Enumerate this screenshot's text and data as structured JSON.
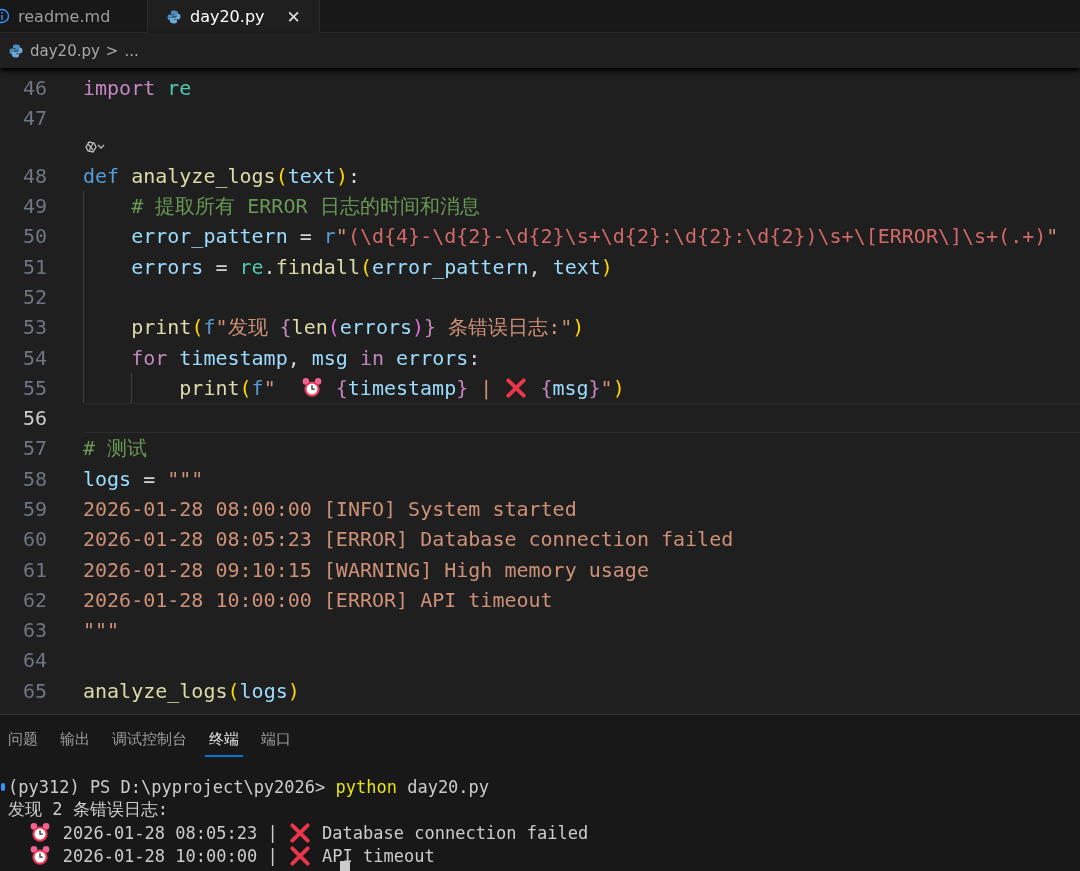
{
  "tabs": [
    {
      "label": "readme.md",
      "selected": false
    },
    {
      "label": "day20.py",
      "selected": true,
      "close": "✕"
    }
  ],
  "breadcrumb": {
    "file": "day20.py",
    "separator": ">",
    "rest": "..."
  },
  "code_lines": [
    {
      "number": "46",
      "active": false,
      "tokens": [
        {
          "kind": "kw",
          "text": "import"
        },
        {
          "kind": "space"
        },
        {
          "kind": "mod",
          "text": "re"
        }
      ]
    },
    {
      "number": "47",
      "active": false
    },
    {
      "kind": "codelens"
    },
    {
      "number": "48",
      "active": false,
      "tokens": [
        {
          "kind": "def",
          "text": "def"
        },
        {
          "kind": "space"
        },
        {
          "kind": "fn",
          "text": "analyze_logs"
        },
        {
          "kind": "p1",
          "text": "("
        },
        {
          "kind": "var",
          "text": "text"
        },
        {
          "kind": "p1",
          "text": ")"
        },
        {
          "kind": "plain",
          "text": ":"
        }
      ]
    },
    {
      "number": "49",
      "active": false,
      "tokens": [
        {
          "kind": "indent"
        },
        {
          "kind": "comment",
          "text": "# 提取所有 ERROR 日志的时间和消息"
        }
      ]
    },
    {
      "number": "50",
      "active": false,
      "tokens": [
        {
          "kind": "indent"
        },
        {
          "kind": "var",
          "text": "error_pattern"
        },
        {
          "kind": "space"
        },
        {
          "kind": "plain",
          "text": "="
        },
        {
          "kind": "space"
        },
        {
          "kind": "def",
          "text": "r"
        },
        {
          "kind": "str",
          "text": "\""
        },
        {
          "kind": "regex",
          "text": "(\\d{4}-\\d{2}-\\d{2}\\s+\\d{2}:\\d{2}:\\d{2})\\s+\\[ERROR\\]\\s+(.+)"
        },
        {
          "kind": "str",
          "text": "\""
        }
      ]
    },
    {
      "number": "51",
      "active": false,
      "tokens": [
        {
          "kind": "indent"
        },
        {
          "kind": "var",
          "text": "errors"
        },
        {
          "kind": "space"
        },
        {
          "kind": "plain",
          "text": "="
        },
        {
          "kind": "space"
        },
        {
          "kind": "mod",
          "text": "re"
        },
        {
          "kind": "plain",
          "text": "."
        },
        {
          "kind": "fn",
          "text": "findall"
        },
        {
          "kind": "p1",
          "text": "("
        },
        {
          "kind": "var",
          "text": "error_pattern"
        },
        {
          "kind": "plain",
          "text": ","
        },
        {
          "kind": "space"
        },
        {
          "kind": "var",
          "text": "text"
        },
        {
          "kind": "p1",
          "text": ")"
        }
      ]
    },
    {
      "number": "52",
      "active": false,
      "tokens": [
        {
          "kind": "indent"
        }
      ]
    },
    {
      "number": "53",
      "active": false,
      "tokens": [
        {
          "kind": "indent"
        },
        {
          "kind": "fn",
          "text": "print"
        },
        {
          "kind": "p1",
          "text": "("
        },
        {
          "kind": "def",
          "text": "f"
        },
        {
          "kind": "str",
          "text": "\"发现"
        },
        {
          "kind": "space"
        },
        {
          "kind": "brace",
          "text": "{"
        },
        {
          "kind": "fn",
          "text": "len"
        },
        {
          "kind": "p2",
          "text": "("
        },
        {
          "kind": "var",
          "text": "errors"
        },
        {
          "kind": "p2",
          "text": ")"
        },
        {
          "kind": "brace",
          "text": "}"
        },
        {
          "kind": "space"
        },
        {
          "kind": "str",
          "text": "条错误日志:\""
        },
        {
          "kind": "p1",
          "text": ")"
        }
      ]
    },
    {
      "number": "54",
      "active": false,
      "tokens": [
        {
          "kind": "indent"
        },
        {
          "kind": "kw",
          "text": "for"
        },
        {
          "kind": "space"
        },
        {
          "kind": "var",
          "text": "timestamp"
        },
        {
          "kind": "plain",
          "text": ","
        },
        {
          "kind": "space"
        },
        {
          "kind": "var",
          "text": "msg"
        },
        {
          "kind": "space"
        },
        {
          "kind": "kw",
          "text": "in"
        },
        {
          "kind": "space"
        },
        {
          "kind": "var",
          "text": "errors"
        },
        {
          "kind": "plain",
          "text": ":"
        }
      ]
    },
    {
      "number": "55",
      "active": false,
      "tokens": [
        {
          "kind": "indent"
        },
        {
          "kind": "indent"
        },
        {
          "kind": "fn",
          "text": "print"
        },
        {
          "kind": "p1",
          "text": "("
        },
        {
          "kind": "def",
          "text": "f"
        },
        {
          "kind": "str",
          "text": "\""
        },
        {
          "kind": "space"
        },
        {
          "kind": "space"
        },
        {
          "kind": "alarm"
        },
        {
          "kind": "space"
        },
        {
          "kind": "brace",
          "text": "{"
        },
        {
          "kind": "var",
          "text": "timestamp"
        },
        {
          "kind": "brace",
          "text": "}"
        },
        {
          "kind": "space"
        },
        {
          "kind": "str",
          "text": "|"
        },
        {
          "kind": "space"
        },
        {
          "kind": "cross"
        },
        {
          "kind": "space"
        },
        {
          "kind": "brace",
          "text": "{"
        },
        {
          "kind": "var",
          "text": "msg"
        },
        {
          "kind": "brace",
          "text": "}"
        },
        {
          "kind": "str",
          "text": "\""
        },
        {
          "kind": "p1",
          "text": ")"
        }
      ]
    },
    {
      "number": "56",
      "active": true
    },
    {
      "number": "57",
      "active": false,
      "tokens": [
        {
          "kind": "comment",
          "text": "# 测试"
        }
      ]
    },
    {
      "number": "58",
      "active": false,
      "tokens": [
        {
          "kind": "var",
          "text": "logs"
        },
        {
          "kind": "space"
        },
        {
          "kind": "plain",
          "text": "="
        },
        {
          "kind": "space"
        },
        {
          "kind": "str",
          "text": "\"\"\""
        }
      ]
    },
    {
      "number": "59",
      "active": false,
      "tokens": [
        {
          "kind": "str",
          "text": "2026-01-28 08:00:00 [INFO] System started"
        }
      ]
    },
    {
      "number": "60",
      "active": false,
      "tokens": [
        {
          "kind": "str",
          "text": "2026-01-28 08:05:23 [ERROR] Database connection failed"
        }
      ]
    },
    {
      "number": "61",
      "active": false,
      "tokens": [
        {
          "kind": "str",
          "text": "2026-01-28 09:10:15 [WARNING] High memory usage"
        }
      ]
    },
    {
      "number": "62",
      "active": false,
      "tokens": [
        {
          "kind": "str",
          "text": "2026-01-28 10:00:00 [ERROR] API timeout"
        }
      ]
    },
    {
      "number": "63",
      "active": false,
      "tokens": [
        {
          "kind": "str",
          "text": "\"\"\""
        }
      ]
    },
    {
      "number": "64",
      "active": false
    },
    {
      "number": "65",
      "active": false,
      "tokens": [
        {
          "kind": "fn",
          "text": "analyze_logs"
        },
        {
          "kind": "p1",
          "text": "("
        },
        {
          "kind": "var",
          "text": "logs"
        },
        {
          "kind": "p1",
          "text": ")"
        }
      ]
    }
  ],
  "panel_tabs": [
    {
      "label": "问题",
      "selected": false
    },
    {
      "label": "输出",
      "selected": false
    },
    {
      "label": "调试控制台",
      "selected": false
    },
    {
      "label": "终端",
      "selected": true
    },
    {
      "label": "端口",
      "selected": false
    }
  ],
  "terminal_lines": [
    {
      "tokens": [
        {
          "kind": "plain",
          "text": "(py312) PS D:\\pyproject\\py2026>"
        },
        {
          "kind": "space"
        },
        {
          "kind": "cmd",
          "text": "python"
        },
        {
          "kind": "space"
        },
        {
          "kind": "plain",
          "text": "day20.py"
        }
      ]
    },
    {
      "tokens": [
        {
          "kind": "plain",
          "text": "发现 2 条错误日志:"
        }
      ]
    },
    {
      "tokens": [
        {
          "kind": "space"
        },
        {
          "kind": "space"
        },
        {
          "kind": "alarm"
        },
        {
          "kind": "space"
        },
        {
          "kind": "plain",
          "text": "2026-01-28 08:05:23 |"
        },
        {
          "kind": "space"
        },
        {
          "kind": "cross"
        },
        {
          "kind": "space"
        },
        {
          "kind": "plain",
          "text": "Database connection failed"
        }
      ]
    },
    {
      "tokens": [
        {
          "kind": "space"
        },
        {
          "kind": "space"
        },
        {
          "kind": "alarm"
        },
        {
          "kind": "space"
        },
        {
          "kind": "plain",
          "text": "2026-01-28 10:00:00 |"
        },
        {
          "kind": "space"
        },
        {
          "kind": "cross"
        },
        {
          "kind": "space"
        },
        {
          "kind": "plain",
          "text": "API timeout"
        }
      ]
    }
  ]
}
